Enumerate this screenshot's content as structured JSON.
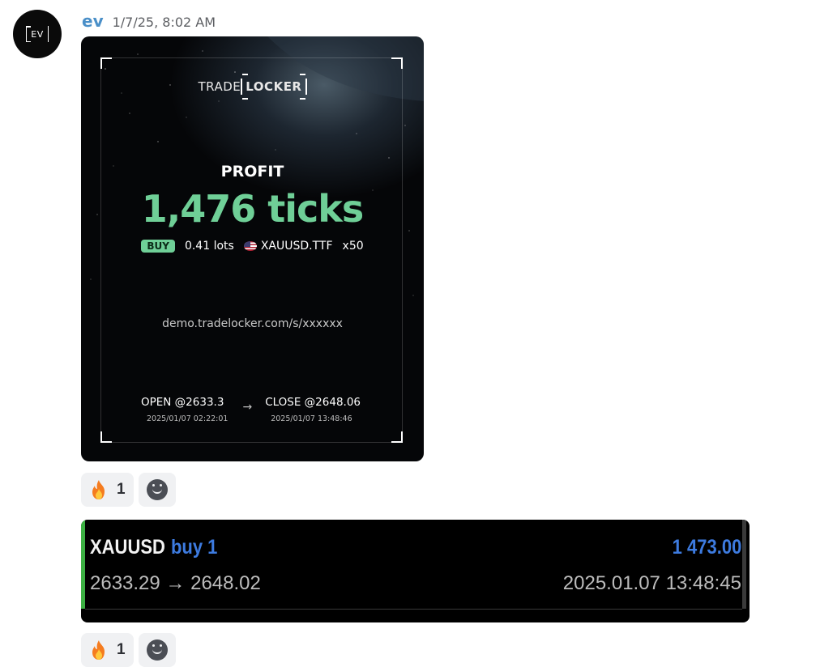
{
  "avatar": {
    "text": "EV"
  },
  "message": {
    "username": "ev",
    "timestamp": "1/7/25, 8:02 AM"
  },
  "card": {
    "brand_prefix": "TRADE",
    "brand_box": "LOCKER",
    "profit_label": "PROFIT",
    "profit_value": "1,476 ticks",
    "side_badge": "BUY",
    "lots": "0.41 lots",
    "symbol": "XAUUSD.TTF",
    "leverage": "x50",
    "url": "demo.tradelocker.com/s/xxxxxx",
    "open_label": "OPEN @2633.3",
    "open_time": "2025/01/07 02:22:01",
    "arrow": "→",
    "close_label": "CLOSE @2648.06",
    "close_time": "2025/01/07 13:48:46",
    "colors": {
      "profit": "#6fcf97"
    }
  },
  "reactions": [
    {
      "emoji": "fire-icon",
      "count": "1"
    },
    {
      "emoji": "fire-icon",
      "count": "1"
    }
  ],
  "trade": {
    "symbol": "XAUUSD",
    "side": "buy 1",
    "profit": "1 473.00",
    "prices": "2633.29 → 2648.02",
    "time": "2025.01.07 13:48:45",
    "colors": {
      "accent": "#3d7be0",
      "bar": "#3cb043"
    }
  }
}
